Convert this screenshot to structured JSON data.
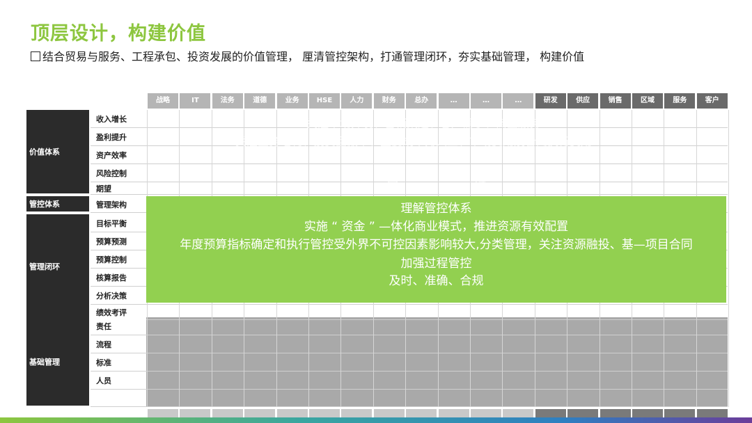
{
  "title": "顶层设计，构建价值",
  "subtitle": "结合贸易与服务、工程承包、投资发展的价值管理，  厘清管控架构，打通管理闭环，夯实基础管理，  构建价值",
  "columns": [
    "战略",
    "IT",
    "法务",
    "道德",
    "业务",
    "HSE",
    "人力",
    "财务",
    "总办",
    "…",
    "…",
    "…",
    "研发",
    "供应",
    "销售",
    "区域",
    "服务",
    "客户"
  ],
  "categories": {
    "value": "价值体系",
    "control": "管控体系",
    "loop": "管理闭环",
    "base": "基础管理"
  },
  "rows": {
    "value": [
      "收入增长",
      "盈利提升",
      "资产效率",
      "风险控制",
      "期望"
    ],
    "control": [
      "管理架构"
    ],
    "loop": [
      "目标平衡",
      "预算预测",
      "预算控制",
      "核算报告",
      "分析决策",
      "绩效考评"
    ],
    "base": [
      "责任",
      "流程",
      "标准",
      "人员"
    ]
  },
  "overlay": {
    "line1": "理解管控体系",
    "line2": "实施  “  资金  ”  —体化商业模式，推进资源有效配置",
    "line3": "年度预算指标确定和执行管控受外界不可控因素影响较大,分类管理，关注资源融投、基—项目合同",
    "line4": "加强过程管控",
    "line5": "及时、准确、合规"
  },
  "ghost": {
    "g1": "关注市场开发、营销渠道、客户需求、商业服务",
    "g2": "关注业务毛利、投资回报率、主要成本为人工、市场费用及合同执行费用",
    "g3": "国",
    "g4": "险"
  },
  "colors": {
    "accent": "#8DC63F",
    "green_block": "#92D050",
    "dark": "#2b2b2b"
  }
}
